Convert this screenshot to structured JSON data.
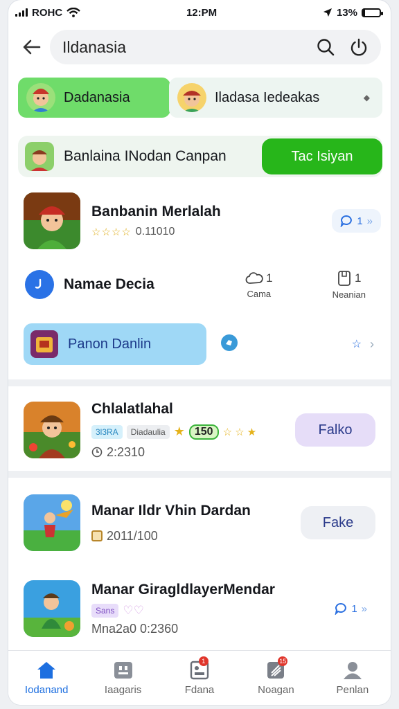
{
  "status_bar": {
    "carrier": "ROHC",
    "time": "12:PM",
    "battery": "13%",
    "battery_level": 0.13,
    "icons": [
      "signal-icon",
      "wifi-icon",
      "location-icon",
      "battery-icon"
    ]
  },
  "search": {
    "query": "Ildanasia",
    "icons": [
      "back-arrow-icon",
      "search-icon",
      "power-icon"
    ]
  },
  "chips": [
    {
      "label": "Dadanasia",
      "icon": "avatar-icon",
      "color": "#6fdc6a"
    },
    {
      "label": "I​ladasa Iedeakas",
      "icon": "avatar-icon",
      "trailing_icon": "diamond-icon"
    }
  ],
  "banner": {
    "label": "Banlaina INodan Canpan",
    "button": "Tac Isiyan",
    "accent": "#27b61a"
  },
  "app1": {
    "title": "Banbanin Merlalah",
    "rating_stars": "☆☆☆☆",
    "rating_text": "0.11010",
    "action_count": "1",
    "action_icons": [
      "comment-icon",
      "double-chevron-icon"
    ]
  },
  "meta": {
    "name": "Namae Decia",
    "stats": [
      {
        "value": "1",
        "label": "Cama",
        "icon": "cloud-icon"
      },
      {
        "value": "1",
        "label": "Neanian",
        "icon": "bookmark-icon"
      }
    ]
  },
  "promo": {
    "label": "Panon Danlin",
    "color": "#9fd8f6",
    "trailing_icons": [
      "blue-badge-icon",
      "star-icon",
      "chevron-right-icon"
    ]
  },
  "app2": {
    "title": "Chlalatlahal",
    "tags": [
      "3l3RA",
      "Diadaulia"
    ],
    "score": "150",
    "stars_left": "★",
    "stars_right": "☆ ☆ ★",
    "sub": "2:2310",
    "button": "Falko"
  },
  "app3": {
    "title": "Manar Ildr Vhin Dardan",
    "sub": "2011/100",
    "button": "Fake"
  },
  "app4": {
    "title": "Manar GiragldlayerMendar",
    "tag": "Sans",
    "sub": "Mna2a0 0:2360",
    "action_count": "1"
  },
  "tabs": [
    {
      "label": "Iodanand",
      "icon": "home-icon",
      "active": true
    },
    {
      "label": "Iaagaris",
      "icon": "grid-icon",
      "active": false
    },
    {
      "label": "Fdana",
      "icon": "card-icon",
      "active": false,
      "badge": "1"
    },
    {
      "label": "Noagan",
      "icon": "notes-icon",
      "active": false,
      "badge": "15"
    },
    {
      "label": "Penlan",
      "icon": "profile-icon",
      "active": false
    }
  ]
}
